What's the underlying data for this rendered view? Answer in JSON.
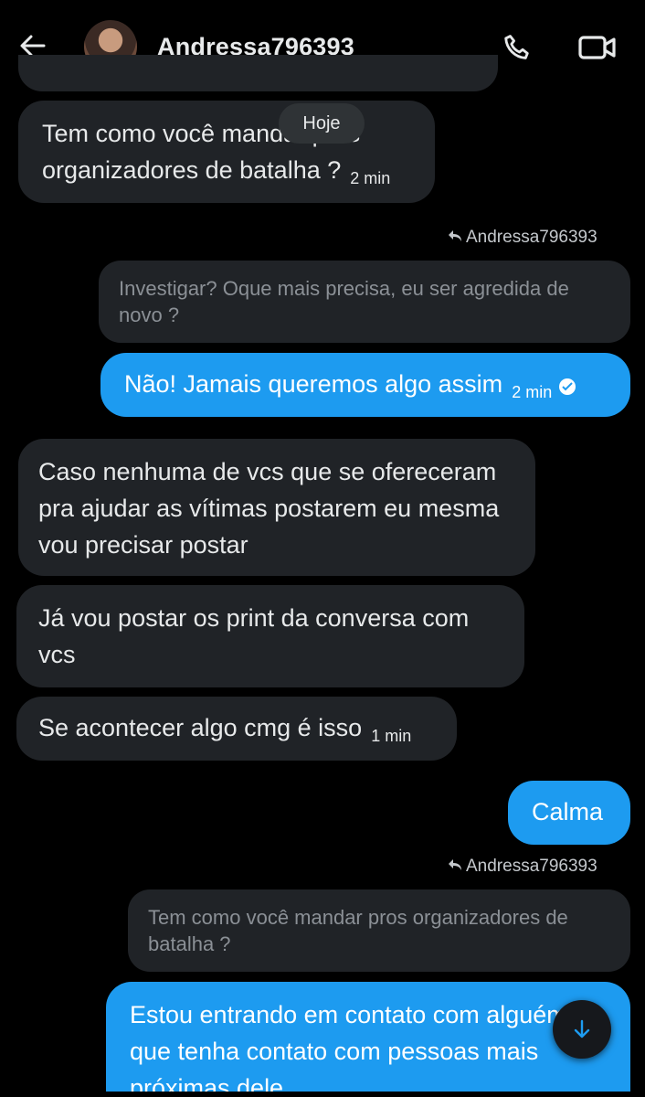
{
  "header": {
    "contact_name": "Andressa796393"
  },
  "date_separator": "Hoje",
  "messages": {
    "m1": {
      "text": "Tem como você mandar pros organizadores de batalha ?",
      "time": "2 min"
    },
    "r1": {
      "reply_to": "Andressa796393",
      "quoted": "Investigar? Oque mais precisa, eu ser agredida de novo ?"
    },
    "m2": {
      "text": "Não! Jamais queremos algo assim",
      "time": "2 min"
    },
    "m3": {
      "text": "Caso nenhuma de vcs que se ofereceram pra ajudar as vítimas postarem eu mesma vou precisar postar"
    },
    "m4": {
      "text": "Já vou postar os print da conversa com vcs"
    },
    "m5": {
      "text": "Se acontecer algo cmg é isso",
      "time": "1 min"
    },
    "m6": {
      "text": "Calma"
    },
    "r2": {
      "reply_to": "Andressa796393",
      "quoted": "Tem como você mandar pros organizadores de batalha ?"
    },
    "m7": {
      "text": "Estou entrando em contato com alguém que tenha contato com pessoas mais próximas dele"
    }
  },
  "colors": {
    "outgoing": "#1d9bf0",
    "incoming": "#202327",
    "background": "#000000"
  },
  "icons": [
    "back-arrow-icon",
    "phone-icon",
    "video-camera-icon",
    "reply-arrow-icon",
    "check-icon",
    "arrow-down-icon"
  ]
}
